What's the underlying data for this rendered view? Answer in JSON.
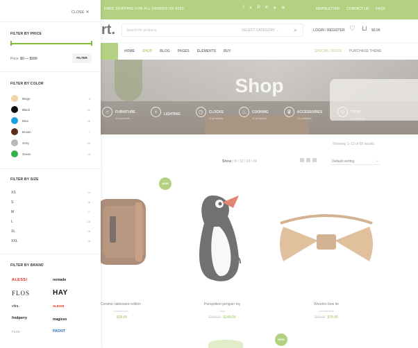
{
  "topbar": {
    "promo": "FREE SHIPPING FOR ALL ORDERS OF $150",
    "social_icons": [
      "facebook-icon",
      "twitter-icon",
      "pinterest-icon",
      "linkedin-icon",
      "telegram-icon",
      "email-icon"
    ],
    "links": [
      "NEWSLETTER",
      "CONTACT US",
      "FAQS"
    ]
  },
  "header": {
    "logo": "rt.",
    "search_placeholder": "Search for products",
    "category_select": "SELECT CATEGORY",
    "login": "LOGIN / REGISTER",
    "cart_total": "$0.00"
  },
  "nav": {
    "items": [
      "HOME",
      "SHOP",
      "BLOG",
      "PAGES",
      "ELEMENTS",
      "BUY"
    ],
    "active": "SHOP",
    "special": "SPECIAL OFFER",
    "purchase": "PURCHASE THEME"
  },
  "hero": {
    "title": "Shop",
    "categories": [
      {
        "name": "FURNITURE",
        "count": "13 products",
        "icon": "chair-icon"
      },
      {
        "name": "LIGHTING",
        "count": "",
        "icon": "lamp-icon"
      },
      {
        "name": "CLOCKS",
        "count": "11 products",
        "icon": "clock-icon"
      },
      {
        "name": "COOKING",
        "count": "11 products",
        "icon": "cooking-icon"
      },
      {
        "name": "ACCESSORIES",
        "count": "12 products",
        "icon": "accessories-icon"
      },
      {
        "name": "TOYS",
        "count": "11 products",
        "icon": "toys-icon"
      }
    ]
  },
  "results": "Showing 1–12 of 65 results",
  "toolbar": {
    "show_label": "Show :",
    "show_options": [
      "9",
      "12",
      "18",
      "24"
    ],
    "sort": "Default sorting"
  },
  "products": [
    {
      "title": "Ceramic tableware edition",
      "category": "Accessories",
      "old_price": "",
      "price": "$29.00",
      "badge": ""
    },
    {
      "title": "Panoptikon penguin toy",
      "category": "Toys",
      "old_price": "$399.00",
      "price": "$249.00",
      "badge": "NEW"
    },
    {
      "title": "Wooden bow tie",
      "category": "Accessories",
      "old_price": "$99.00",
      "price": "$79.00",
      "badge": ""
    }
  ],
  "sidebar": {
    "close": "CLOSE",
    "price": {
      "title": "FILTER BY PRICE",
      "label": "Price:",
      "range": "$0 — $999",
      "button": "FILTER",
      "slider_min_fraction": 0,
      "slider_max_fraction": 1
    },
    "color": {
      "title": "FILTER BY COLOR",
      "items": [
        {
          "name": "Beige",
          "count": "3",
          "hex": "#f1d3a8"
        },
        {
          "name": "Black",
          "count": "21",
          "hex": "#111111"
        },
        {
          "name": "Blue",
          "count": "18",
          "hex": "#1e9fe0"
        },
        {
          "name": "Brown",
          "count": "7",
          "hex": "#5a2e1b"
        },
        {
          "name": "Gray",
          "count": "20",
          "hex": "#b8b8b8"
        },
        {
          "name": "Green",
          "count": "13",
          "hex": "#36b24a"
        }
      ]
    },
    "size": {
      "title": "FILTER BY SIZE",
      "items": [
        {
          "name": "XS",
          "count": "14"
        },
        {
          "name": "S",
          "count": "16"
        },
        {
          "name": "M",
          "count": "17"
        },
        {
          "name": "L",
          "count": "15"
        },
        {
          "name": "XL",
          "count": "15"
        },
        {
          "name": "XXL",
          "count": "15"
        }
      ]
    },
    "brand": {
      "title": "FILTER BY BRAND",
      "items": [
        {
          "name": "ALESSI",
          "color": "#e2231a"
        },
        {
          "name": "nomade",
          "color": "#222222"
        },
        {
          "name": "FLOS",
          "color": "#222222"
        },
        {
          "name": "HAY",
          "color": "#111111"
        },
        {
          "name": "vitra.",
          "color": "#222222"
        },
        {
          "name": "ALESSI",
          "color": "#e2231a"
        },
        {
          "name": "fredperry",
          "color": "#222222"
        },
        {
          "name": "magisso",
          "color": "#222222"
        },
        {
          "name": "FLOS",
          "color": "#999999"
        },
        {
          "name": "PACKIT",
          "color": "#1e6fb8"
        }
      ]
    }
  },
  "colors": {
    "accent": "#83b735"
  }
}
